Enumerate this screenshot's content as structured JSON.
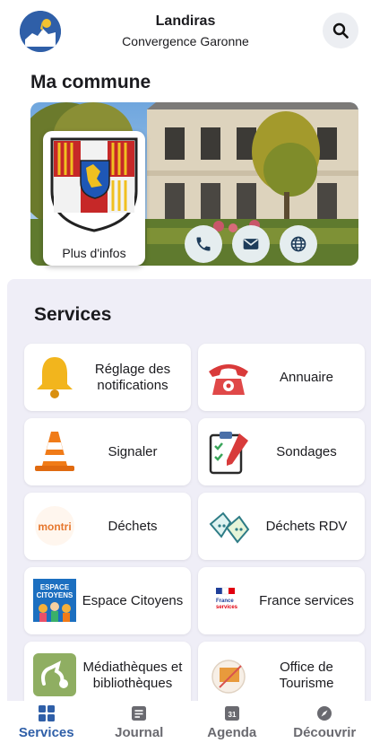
{
  "header": {
    "title": "Landiras",
    "subtitle": "Convergence Garonne"
  },
  "commune": {
    "title": "Ma commune",
    "more_info": "Plus d'infos"
  },
  "services": {
    "title": "Services",
    "tiles": [
      {
        "label": "Réglage des notifications",
        "icon": "bell-icon"
      },
      {
        "label": "Annuaire",
        "icon": "telephone-icon"
      },
      {
        "label": "Signaler",
        "icon": "traffic-cone-icon"
      },
      {
        "label": "Sondages",
        "icon": "clipboard-icon"
      },
      {
        "label": "Déchets",
        "icon": "montri-logo-icon"
      },
      {
        "label": "Déchets RDV",
        "icon": "recycling-bags-icon"
      },
      {
        "label": "Espace Citoyens",
        "icon": "espace-citoyens-logo"
      },
      {
        "label": "France services",
        "icon": "france-services-logo"
      },
      {
        "label": "Médiathèques et bibliothèques",
        "icon": "library-icon"
      },
      {
        "label": "Office de Tourisme",
        "icon": "tourism-icon"
      }
    ]
  },
  "nav": {
    "items": [
      {
        "label": "Services",
        "icon": "grid-icon",
        "active": true
      },
      {
        "label": "Journal",
        "icon": "newspaper-icon"
      },
      {
        "label": "Agenda",
        "icon": "calendar-icon",
        "badge": "31"
      },
      {
        "label": "Découvrir",
        "icon": "compass-icon"
      }
    ]
  },
  "colors": {
    "accent": "#2f5fa8",
    "services_bg": "#efeef7",
    "contact_btn_bg": "#e5edef"
  }
}
